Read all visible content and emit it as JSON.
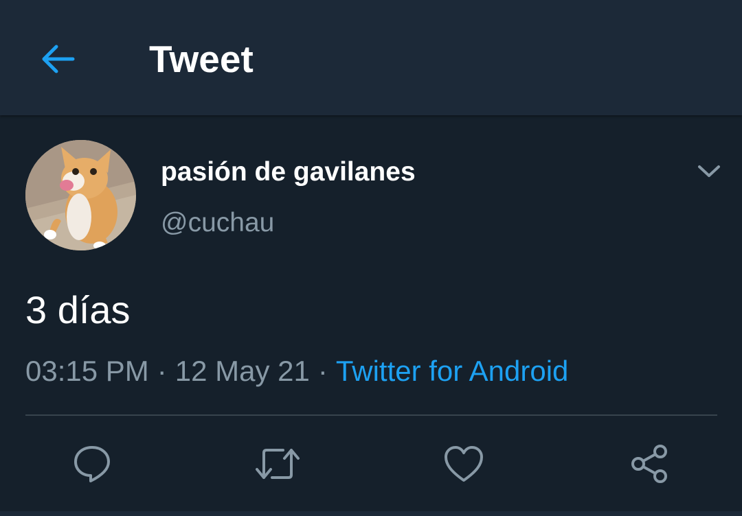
{
  "header": {
    "title": "Tweet",
    "back_icon": "arrow-left-icon"
  },
  "tweet": {
    "author": {
      "display_name": "pasión de gavilanes",
      "handle": "@cuchau",
      "avatar": "cat-avatar"
    },
    "text": "3 días",
    "time": "03:15 PM",
    "date": "12 May 21",
    "separator": "·",
    "source": "Twitter for Android",
    "menu_icon": "chevron-down-icon"
  },
  "actions": [
    {
      "icon": "reply-icon"
    },
    {
      "icon": "retweet-icon"
    },
    {
      "icon": "like-icon"
    },
    {
      "icon": "share-icon"
    }
  ],
  "colors": {
    "background": "#15202b",
    "header_background": "#1c2938",
    "accent": "#1da1f2",
    "secondary_text": "#8899a6",
    "primary_text": "#ffffff",
    "divider": "#38444d"
  }
}
